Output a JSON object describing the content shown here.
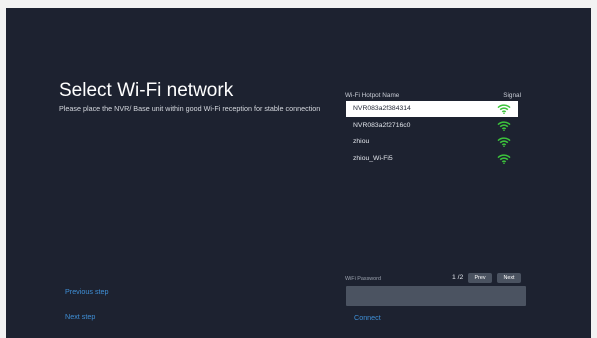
{
  "setup": {
    "title": "Select Wi-Fi network",
    "subtitle": "Please place the NVR/ Base unit within good Wi-Fi reception for stable connection"
  },
  "wifi": {
    "header_name": "Wi-Fi Hotpot Name",
    "header_signal": "Signal",
    "networks": [
      {
        "name": "NVR083a2f384314",
        "selected": true,
        "signal_icon": "wifi-full-icon"
      },
      {
        "name": "NVR083a2f2716c0",
        "selected": false,
        "signal_icon": "wifi-full-icon"
      },
      {
        "name": "zhiou",
        "selected": false,
        "signal_icon": "wifi-full-icon"
      },
      {
        "name": "zhiou_Wi-Fi5",
        "selected": false,
        "signal_icon": "wifi-full-icon"
      }
    ],
    "signal_color": "#3cc43c"
  },
  "password": {
    "label": "WiFi Password",
    "value": "",
    "page_indicator": "1 /2",
    "prev_label": "Prev",
    "next_label": "Next"
  },
  "nav": {
    "previous_step": "Previous step",
    "next_step": "Next step",
    "connect": "Connect"
  }
}
